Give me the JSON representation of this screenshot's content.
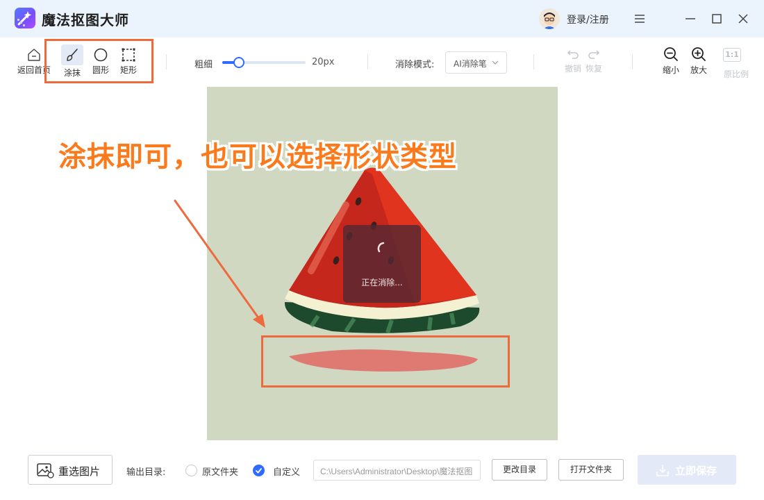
{
  "app": {
    "title": "魔法抠图大师",
    "login": "登录/注册"
  },
  "toolbar": {
    "home": "返回首页",
    "smear": "涂抹",
    "circle": "圆形",
    "rect": "矩形",
    "thickness_label": "粗细",
    "thickness_value": "20px",
    "thickness_fraction": 0.2,
    "mode_label": "消除模式:",
    "mode_value": "AI消除笔",
    "undo": "撤销",
    "redo": "恢复",
    "zoom_out": "缩小",
    "zoom_in": "放大",
    "ratio_box": "1:1",
    "original": "原比例"
  },
  "canvas": {
    "annotation": "涂抹即可，也可以选择形状类型",
    "loading": "正在消除..."
  },
  "bottom": {
    "reselect": "重选图片",
    "output_label": "输出目录:",
    "opt_original": "原文件夹",
    "opt_custom": "自定义",
    "path": "C:\\Users\\Administrator\\Desktop\\魔法抠图",
    "change_dir": "更改目录",
    "open_folder": "打开文件夹",
    "save": "立即保存"
  },
  "colors": {
    "accent": "#2f6bff",
    "annotation": "#fb7a1c",
    "highlight_box": "#ec6a3c"
  }
}
